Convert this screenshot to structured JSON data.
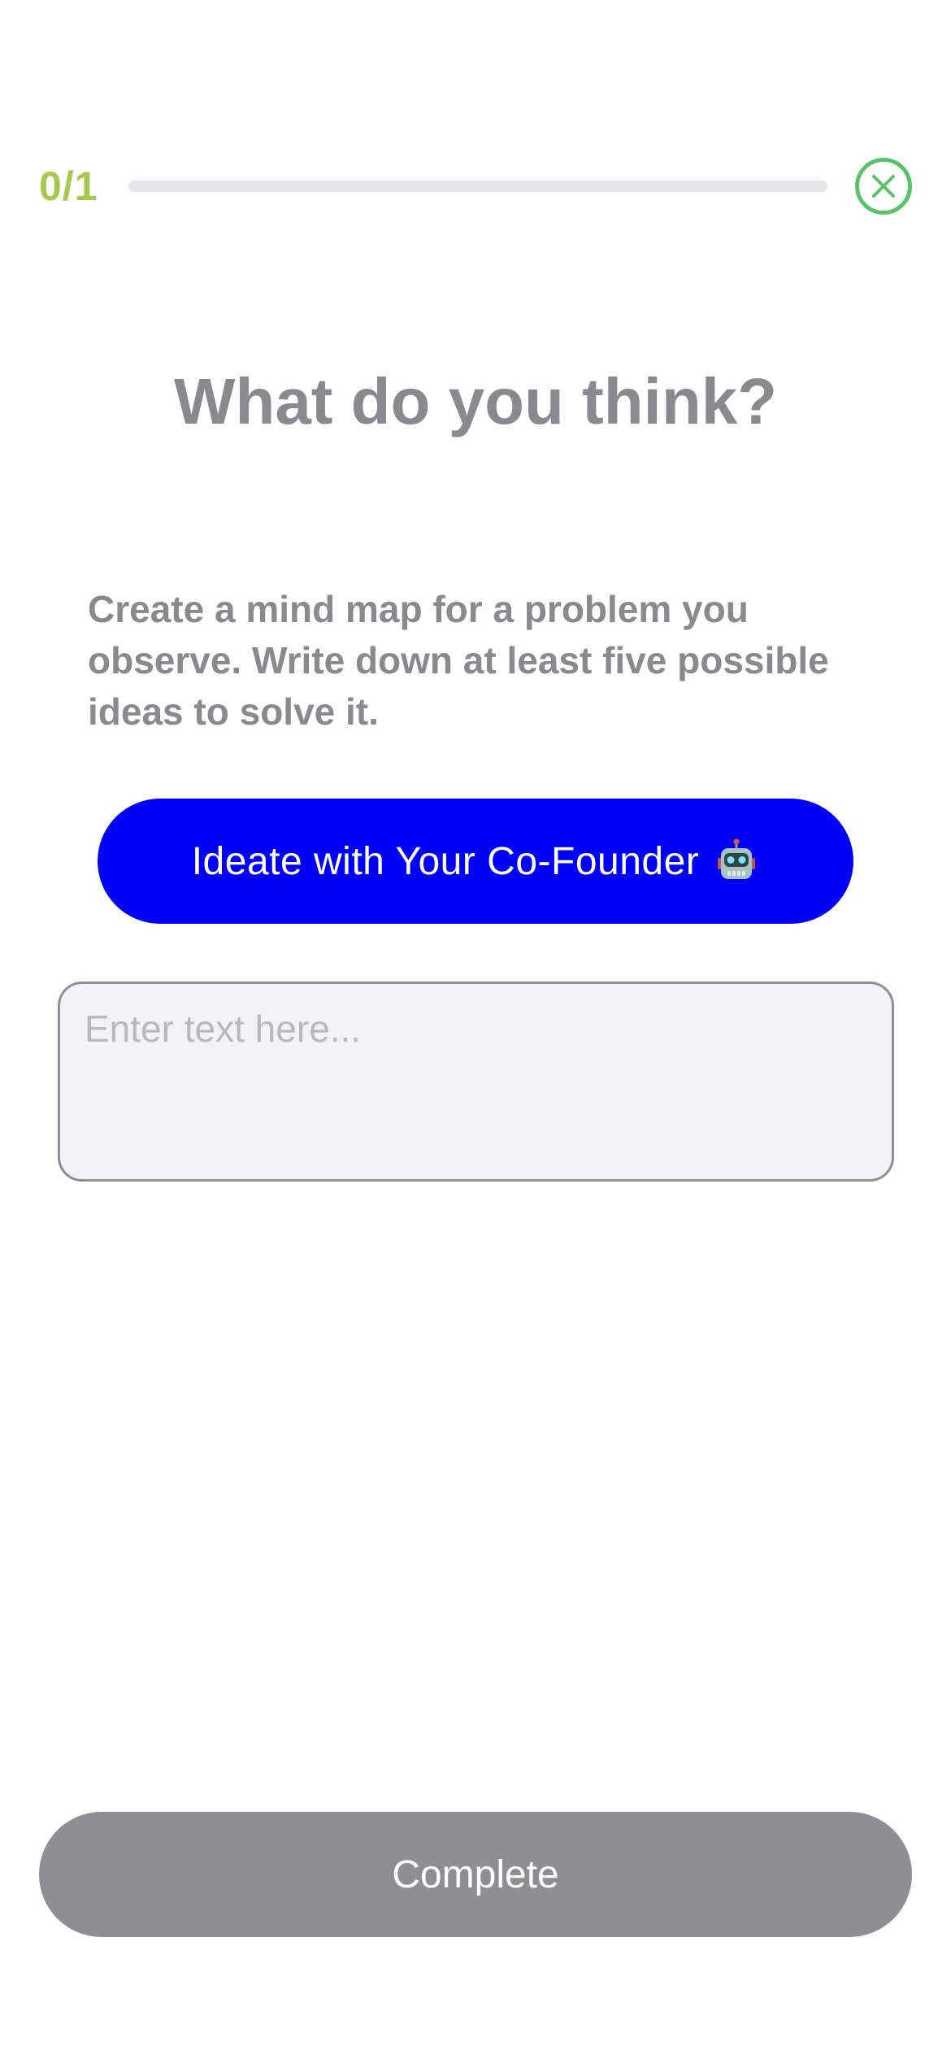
{
  "header": {
    "progress_text": "0/1",
    "progress_fraction": 0,
    "progress_color": "#a5c84f",
    "close_icon": "close-circle-icon",
    "close_color": "#5ac36a"
  },
  "main": {
    "title": "What do you think?",
    "prompt": "Create a mind map for a problem you observe. Write down at least five possible ideas to solve it.",
    "ideate_button": {
      "label": "Ideate with Your Co-Founder",
      "icon": "robot-icon",
      "color": "#0000f5"
    },
    "answer_input": {
      "value": "",
      "placeholder": "Enter text here..."
    }
  },
  "footer": {
    "complete_label": "Complete",
    "complete_color": "#8e8e93"
  }
}
